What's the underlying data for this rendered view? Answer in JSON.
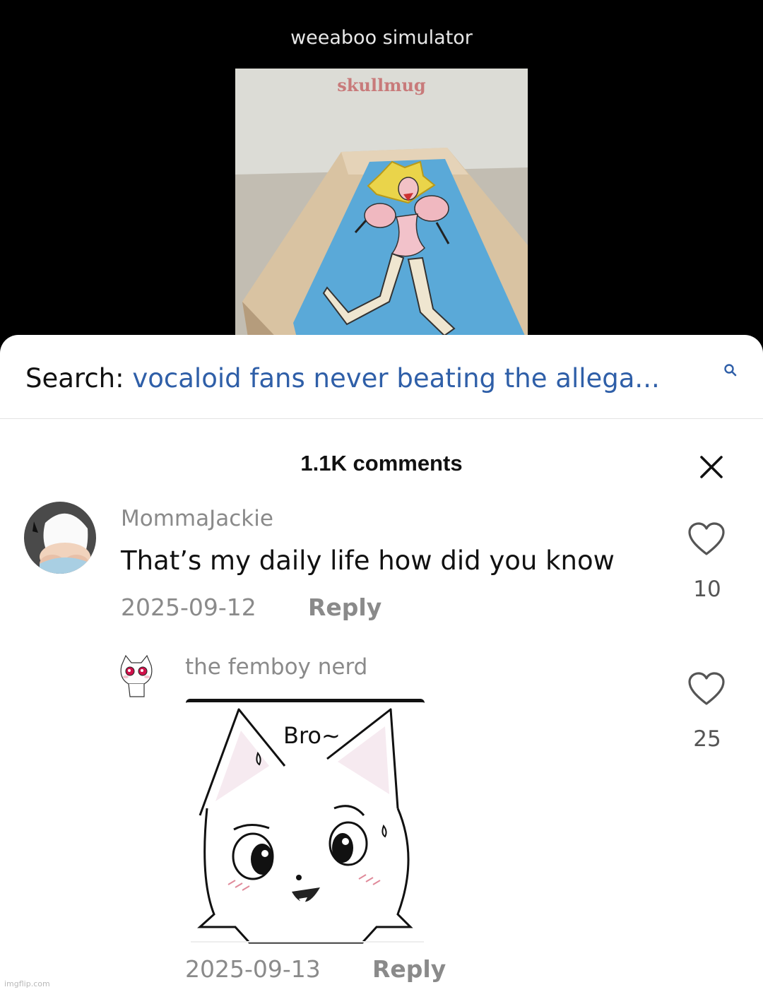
{
  "video": {
    "caption": "weeaboo simulator",
    "watermark_text": "skullmug"
  },
  "search": {
    "label": "Search:",
    "query": "vocaloid fans never beating the allega..."
  },
  "comments_header": {
    "count_label": "1.1K comments"
  },
  "comments": [
    {
      "username": "MommaJackie",
      "text": "That’s my daily life how did you know",
      "date": "2025-09-12",
      "reply_label": "Reply",
      "likes": "10"
    },
    {
      "username": "the femboy nerd",
      "sticker_text": "Bro~",
      "date": "2025-09-13",
      "reply_label": "Reply",
      "likes": "25"
    }
  ],
  "footer": {
    "watermark": "imgflip.com"
  },
  "colors": {
    "query_blue": "#2f5fa8",
    "muted_gray": "#8a8a8a",
    "pillow_blue": "#5aa9d8"
  }
}
